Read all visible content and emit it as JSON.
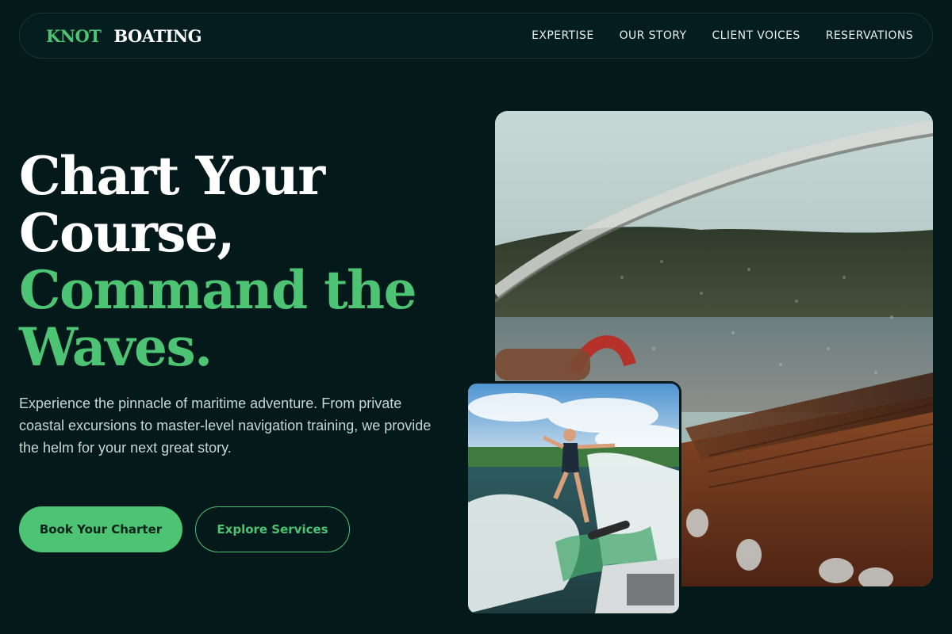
{
  "brand": {
    "part1": "KNOT",
    "part2": "BOATING"
  },
  "nav": {
    "links": [
      "EXPERTISE",
      "OUR STORY",
      "CLIENT VOICES",
      "RESERVATIONS"
    ]
  },
  "hero": {
    "headline": {
      "line1": "Chart Your",
      "line2": "Course,",
      "line3": "Command the",
      "line4": "Waves."
    },
    "lead": "Experience the pinnacle of maritime adventure. From private coastal excursions to master-level navigation training, we provide the helm for your next great story.",
    "primary_cta": "Book Your Charter",
    "secondary_cta": "Explore Services"
  },
  "colors": {
    "background": "#03191a",
    "accent": "#4dc374",
    "text": "#ffffff"
  }
}
